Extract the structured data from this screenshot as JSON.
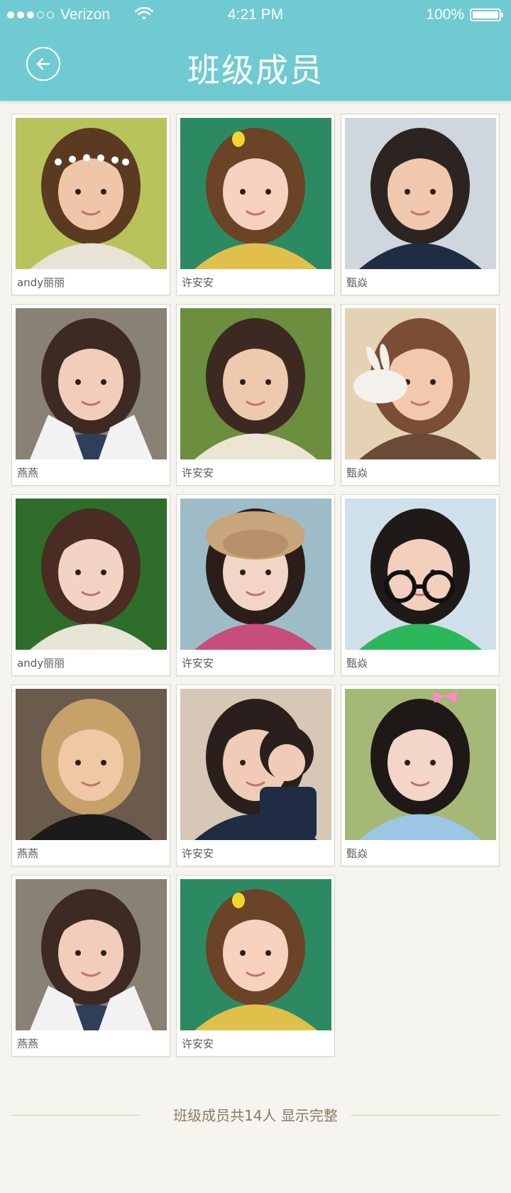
{
  "status": {
    "carrier": "Verizon",
    "time": "4:21 PM",
    "battery": "100%",
    "signal_bars_filled": 3,
    "signal_bars_total": 5
  },
  "nav": {
    "title": "班级成员",
    "back_icon": "back-arrow-icon"
  },
  "members": [
    {
      "name": "andy丽丽",
      "photo": {
        "bg": "#b9c35c",
        "hair": "#5b3a22",
        "skin": "#f0c6a8",
        "cloth": "#e8e2d8",
        "accessory": "flower-crown"
      }
    },
    {
      "name": "许安安",
      "photo": {
        "bg": "#2c8a63",
        "hair": "#6b4327",
        "skin": "#f6d2bf",
        "cloth": "#e0c04a",
        "accessory": "duck-clip"
      }
    },
    {
      "name": "甄焱",
      "photo": {
        "bg": "#cfd6dd",
        "hair": "#2c2420",
        "skin": "#f0c8ae",
        "cloth": "#1f2c43",
        "accessory": "none"
      }
    },
    {
      "name": "燕燕",
      "photo": {
        "bg": "#8a8175",
        "hair": "#3d2a23",
        "skin": "#f2cdbb",
        "cloth": "#2f3f5a",
        "accessory": "white-jacket"
      }
    },
    {
      "name": "许安安",
      "photo": {
        "bg": "#6b8f3e",
        "hair": "#3c2a22",
        "skin": "#efc9ae",
        "cloth": "#ece5d3",
        "accessory": "none"
      }
    },
    {
      "name": "甄焱",
      "photo": {
        "bg": "#e5d2b5",
        "hair": "#7b4d36",
        "skin": "#f2c9ad",
        "cloth": "#6b4a38",
        "accessory": "rabbit"
      }
    },
    {
      "name": "andy丽丽",
      "photo": {
        "bg": "#2e6d2a",
        "hair": "#4a2c22",
        "skin": "#f3d3c4",
        "cloth": "#e6e5d6",
        "accessory": "none"
      }
    },
    {
      "name": "许安安",
      "photo": {
        "bg": "#9ebcc8",
        "hair": "#2b1e19",
        "skin": "#f2d5c7",
        "cloth": "#c74d7b",
        "accessory": "straw-hat"
      }
    },
    {
      "name": "甄焱",
      "photo": {
        "bg": "#cfe0ea",
        "hair": "#1f1a18",
        "skin": "#f2d0bd",
        "cloth": "#2cb75a",
        "accessory": "glasses"
      }
    },
    {
      "name": "燕燕",
      "photo": {
        "bg": "#6a5b4d",
        "hair": "#c7a16a",
        "skin": "#efc8a6",
        "cloth": "#1b1b1b",
        "accessory": "none"
      }
    },
    {
      "name": "许安安",
      "photo": {
        "bg": "#d6c7b6",
        "hair": "#2a1f1c",
        "skin": "#f0ccb8",
        "cloth": "#1f2c43",
        "accessory": "two-girls"
      }
    },
    {
      "name": "甄焱",
      "photo": {
        "bg": "#a6b878",
        "hair": "#1e1917",
        "skin": "#f3d6c7",
        "cloth": "#9cc5e6",
        "accessory": "pink-bow"
      }
    },
    {
      "name": "燕燕",
      "photo": {
        "bg": "#8a8175",
        "hair": "#3d2a23",
        "skin": "#f2cdbb",
        "cloth": "#2f3f5a",
        "accessory": "white-jacket"
      }
    },
    {
      "name": "许安安",
      "photo": {
        "bg": "#2c8a63",
        "hair": "#6b4327",
        "skin": "#f6d2bf",
        "cloth": "#e0c04a",
        "accessory": "duck-clip"
      }
    }
  ],
  "footer": {
    "summary": "班级成员共14人  显示完整"
  },
  "colors": {
    "header": "#6fcbd1",
    "background": "#f6f4ef",
    "footer_text": "#8a7a63"
  }
}
